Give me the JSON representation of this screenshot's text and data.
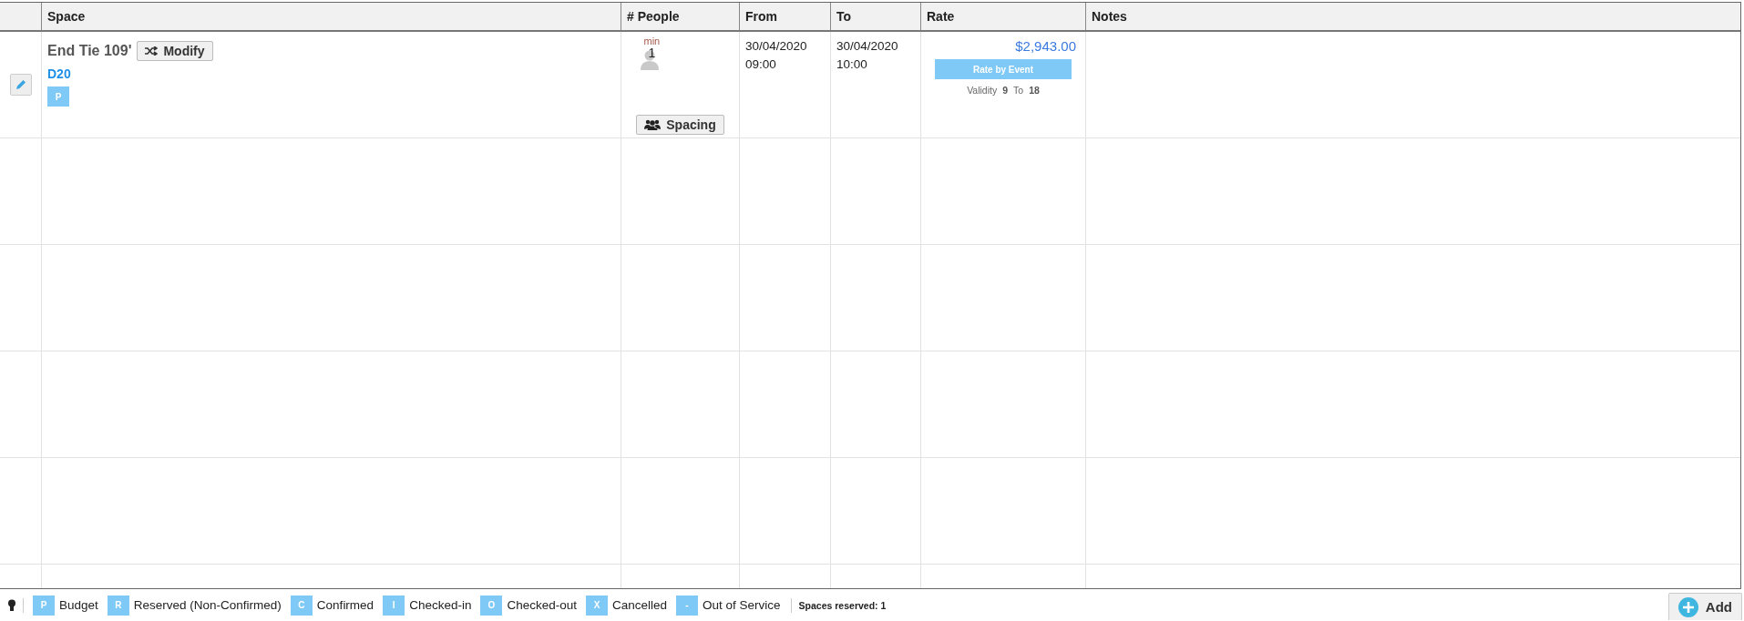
{
  "table": {
    "columns": [
      "Space",
      "# People",
      "From",
      "To",
      "Rate",
      "Notes"
    ],
    "rows": [
      {
        "space": "End Tie 109'",
        "modify_button": "Modify",
        "code": "D20",
        "status_badge": "P",
        "people_label": "min",
        "people_count": "1",
        "spacing_button": "Spacing",
        "from_date": "30/04/2020",
        "from_time": "09:00",
        "to_date": "30/04/2020",
        "to_time": "10:00",
        "rate": "$2,943.00",
        "rate_type": "Rate by Event",
        "validity_label": "Validity",
        "validity_from": "9",
        "validity_to_label": "To",
        "validity_to": "18"
      }
    ]
  },
  "legend": [
    {
      "letter": "P",
      "label": "Budget"
    },
    {
      "letter": "R",
      "label": "Reserved (Non-Confirmed)"
    },
    {
      "letter": "C",
      "label": "Confirmed"
    },
    {
      "letter": "I",
      "label": "Checked-in"
    },
    {
      "letter": "O",
      "label": "Checked-out"
    },
    {
      "letter": "X",
      "label": "Cancelled"
    },
    {
      "letter": "-",
      "label": "Out of Service"
    }
  ],
  "spaces_reserved": "Spaces reserved: 1",
  "add_button": "Add"
}
